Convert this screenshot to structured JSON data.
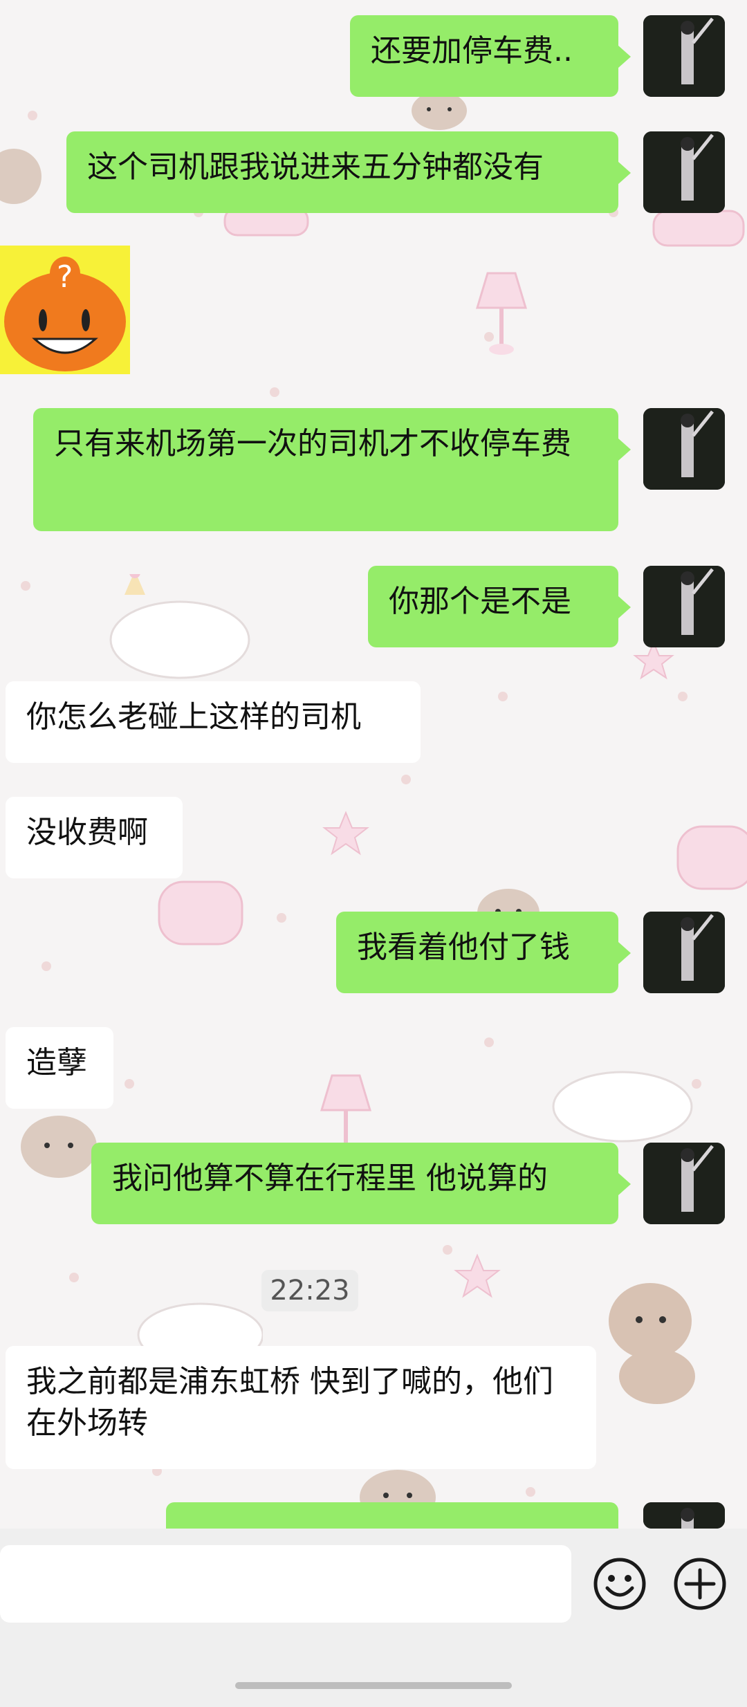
{
  "messages": [
    {
      "side": "out",
      "text": "还要加停车费.."
    },
    {
      "side": "out",
      "text": "这个司机跟我说进来五分钟都没有"
    },
    {
      "side": "in",
      "type": "sticker",
      "sticker": "orange-question-face"
    },
    {
      "side": "out",
      "text": "只有来机场第一次的司机才不收停车费"
    },
    {
      "side": "out",
      "text": "你那个是不是"
    },
    {
      "side": "in",
      "text": "你怎么老碰上这样的司机"
    },
    {
      "side": "in",
      "text": "没收费啊"
    },
    {
      "side": "out",
      "text": "我看着他付了钱"
    },
    {
      "side": "in",
      "text": "造孽"
    },
    {
      "side": "out",
      "text": "我问他算不算在行程里 他说算的"
    },
    {
      "side": "in",
      "text": "我之前都是浦东虹桥 快到了喊的，他们在外场转"
    }
  ],
  "timestamp": "22:23",
  "icons": {
    "emoji": "emoji-smile-icon",
    "plus": "plus-circle-icon"
  },
  "colors": {
    "outgoing_bubble": "#95ec69",
    "incoming_bubble": "#ffffff",
    "background": "#f6f4f4"
  }
}
